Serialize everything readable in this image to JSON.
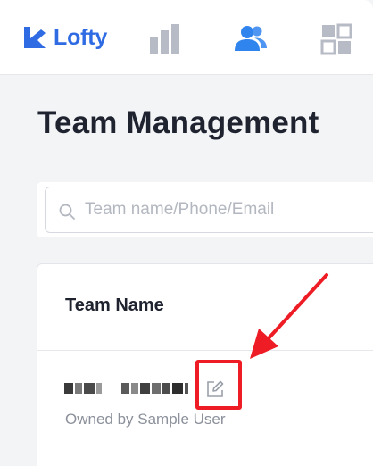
{
  "nav": {
    "logo_text": "Lofty",
    "items": [
      {
        "icon": "bar-chart-icon",
        "active": false
      },
      {
        "icon": "team-icon",
        "active": true
      },
      {
        "icon": "apps-grid-icon",
        "active": false
      }
    ]
  },
  "page": {
    "title": "Team Management"
  },
  "search": {
    "placeholder": "Team name/Phone/Email",
    "value": ""
  },
  "table": {
    "columns": [
      "Team Name"
    ],
    "rows": [
      {
        "team_name": "",
        "owner": "Owned by Sample User",
        "action_icon": "edit-icon"
      }
    ]
  },
  "colors": {
    "brand": "#2f6be3",
    "active_nav": "#2f84ee",
    "inactive_nav": "#b7bbc6",
    "annotation": "#ee1c24"
  }
}
